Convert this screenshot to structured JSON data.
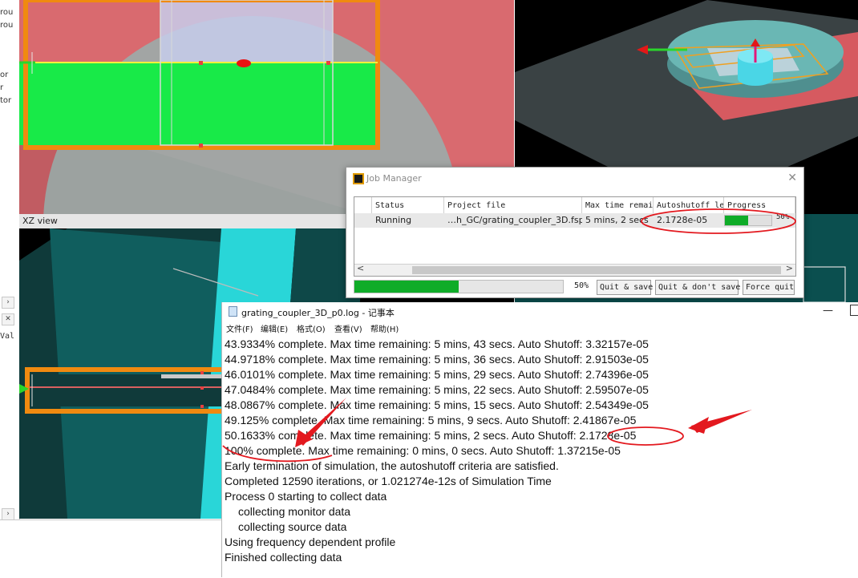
{
  "xz_view": {
    "label": "XZ view"
  },
  "object_tree": {
    "fragments": [
      "rou",
      "rou",
      "or",
      "r",
      "tor"
    ],
    "scroll_glyph": "›",
    "close_glyph": "✕",
    "val_fragment": "Val",
    "scroll_glyph_bottom": "›"
  },
  "job_manager": {
    "title": "Job Manager",
    "columns": [
      "Status",
      "Project file",
      "Max time remair",
      "Autoshutoff le:",
      "Progress"
    ],
    "row": {
      "status": "Running",
      "project_file": "…h_GC/grating_coupler_3D.fsp\"",
      "max_time": "5 mins, 2 secs",
      "autoshutoff": "2.1728e-05",
      "progress_label": "50%",
      "progress_value": 0.5
    },
    "overall_progress_label": "50%",
    "overall_progress_value": 0.5,
    "buttons": {
      "quit_save": "Quit & save",
      "quit_nosave": "Quit & don't save",
      "force_quit": "Force quit"
    },
    "scroll_left": "<",
    "scroll_right": ">",
    "close_glyph": "✕"
  },
  "notepad": {
    "title": "grating_coupler_3D_p0.log - 记事本",
    "minimize_glyph": "—",
    "menu": [
      "文件(F)",
      "编辑(E)",
      "格式(O)",
      "查看(V)",
      "帮助(H)"
    ],
    "lines": [
      "43.9334% complete. Max time remaining: 5 mins, 43 secs. Auto Shutoff: 3.32157e-05",
      "44.9718% complete. Max time remaining: 5 mins, 36 secs. Auto Shutoff: 2.91503e-05",
      "46.0101% complete. Max time remaining: 5 mins, 29 secs. Auto Shutoff: 2.74396e-05",
      "47.0484% complete. Max time remaining: 5 mins, 22 secs. Auto Shutoff: 2.59507e-05",
      "48.0867% complete. Max time remaining: 5 mins, 15 secs. Auto Shutoff: 2.54349e-05",
      "49.125% complete. Max time remaining: 5 mins, 9 secs. Auto Shutoff: 2.41867e-05",
      "50.1633% complete. Max time remaining: 5 mins, 2 secs. Auto Shutoff: 2.1728e-05",
      "100% complete. Max time remaining: 0 mins, 0 secs. Auto Shutoff: 1.37215e-05",
      "Early termination of simulation, the autoshutoff criteria are satisfied.",
      "Completed 12590 iterations, or 1.021274e-12s of Simulation Time",
      "Process 0 starting to collect data",
      "collecting monitor data",
      "collecting source data",
      "Using frequency dependent profile",
      "Finished collecting data"
    ]
  },
  "colors": {
    "annotation_red": "#e3191f",
    "progress_green": "#0fac28"
  }
}
